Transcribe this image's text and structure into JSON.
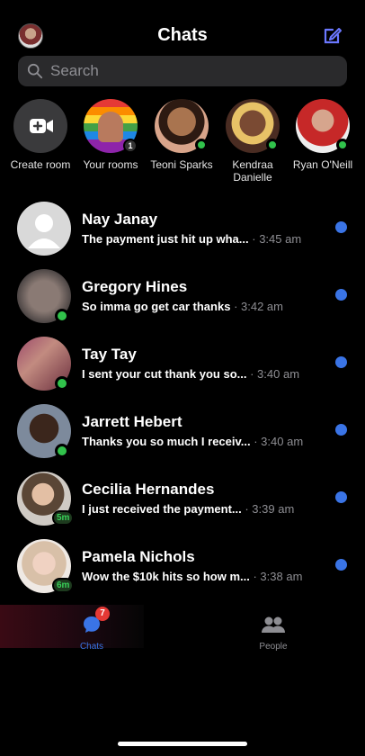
{
  "header": {
    "title": "Chats",
    "avatar_icon": "profile-avatar",
    "compose_icon": "compose-icon"
  },
  "search": {
    "placeholder": "Search"
  },
  "stories": [
    {
      "label": "Create room",
      "kind": "create"
    },
    {
      "label": "Your rooms",
      "badge": "1"
    },
    {
      "label": "Teoni Sparks",
      "online": true
    },
    {
      "label": "Kendraa Danielle",
      "online": true
    },
    {
      "label": "Ryan O'Neill",
      "online": true
    }
  ],
  "chats": [
    {
      "name": "Nay Janay",
      "preview": "The payment just hit up wha...",
      "time": "· 3:45 am",
      "status": "none",
      "unread": true
    },
    {
      "name": "Gregory Hines",
      "preview": "So imma go get car thanks",
      "time": "· 3:42 am",
      "status": "online",
      "unread": true
    },
    {
      "name": "Tay Tay",
      "preview": "I sent your cut thank you so...",
      "time": "· 3:40 am",
      "status": "online",
      "unread": true
    },
    {
      "name": "Jarrett Hebert",
      "preview": "Thanks you so much I receiv...",
      "time": "· 3:40 am",
      "status": "online",
      "unread": true
    },
    {
      "name": "Cecilia Hernandes",
      "preview": "I just received the payment...",
      "time": "· 3:39 am",
      "status": "5m",
      "unread": true
    },
    {
      "name": "Pamela Nichols",
      "preview": "Wow the $10k hits so how m...",
      "time": "· 3:38 am",
      "status": "6m",
      "unread": true
    }
  ],
  "tabs": {
    "chats": {
      "label": "Chats",
      "badge": "7"
    },
    "people": {
      "label": "People"
    }
  },
  "colors": {
    "accent": "#3a74e6",
    "online": "#31c24b",
    "badge": "#e53935"
  }
}
